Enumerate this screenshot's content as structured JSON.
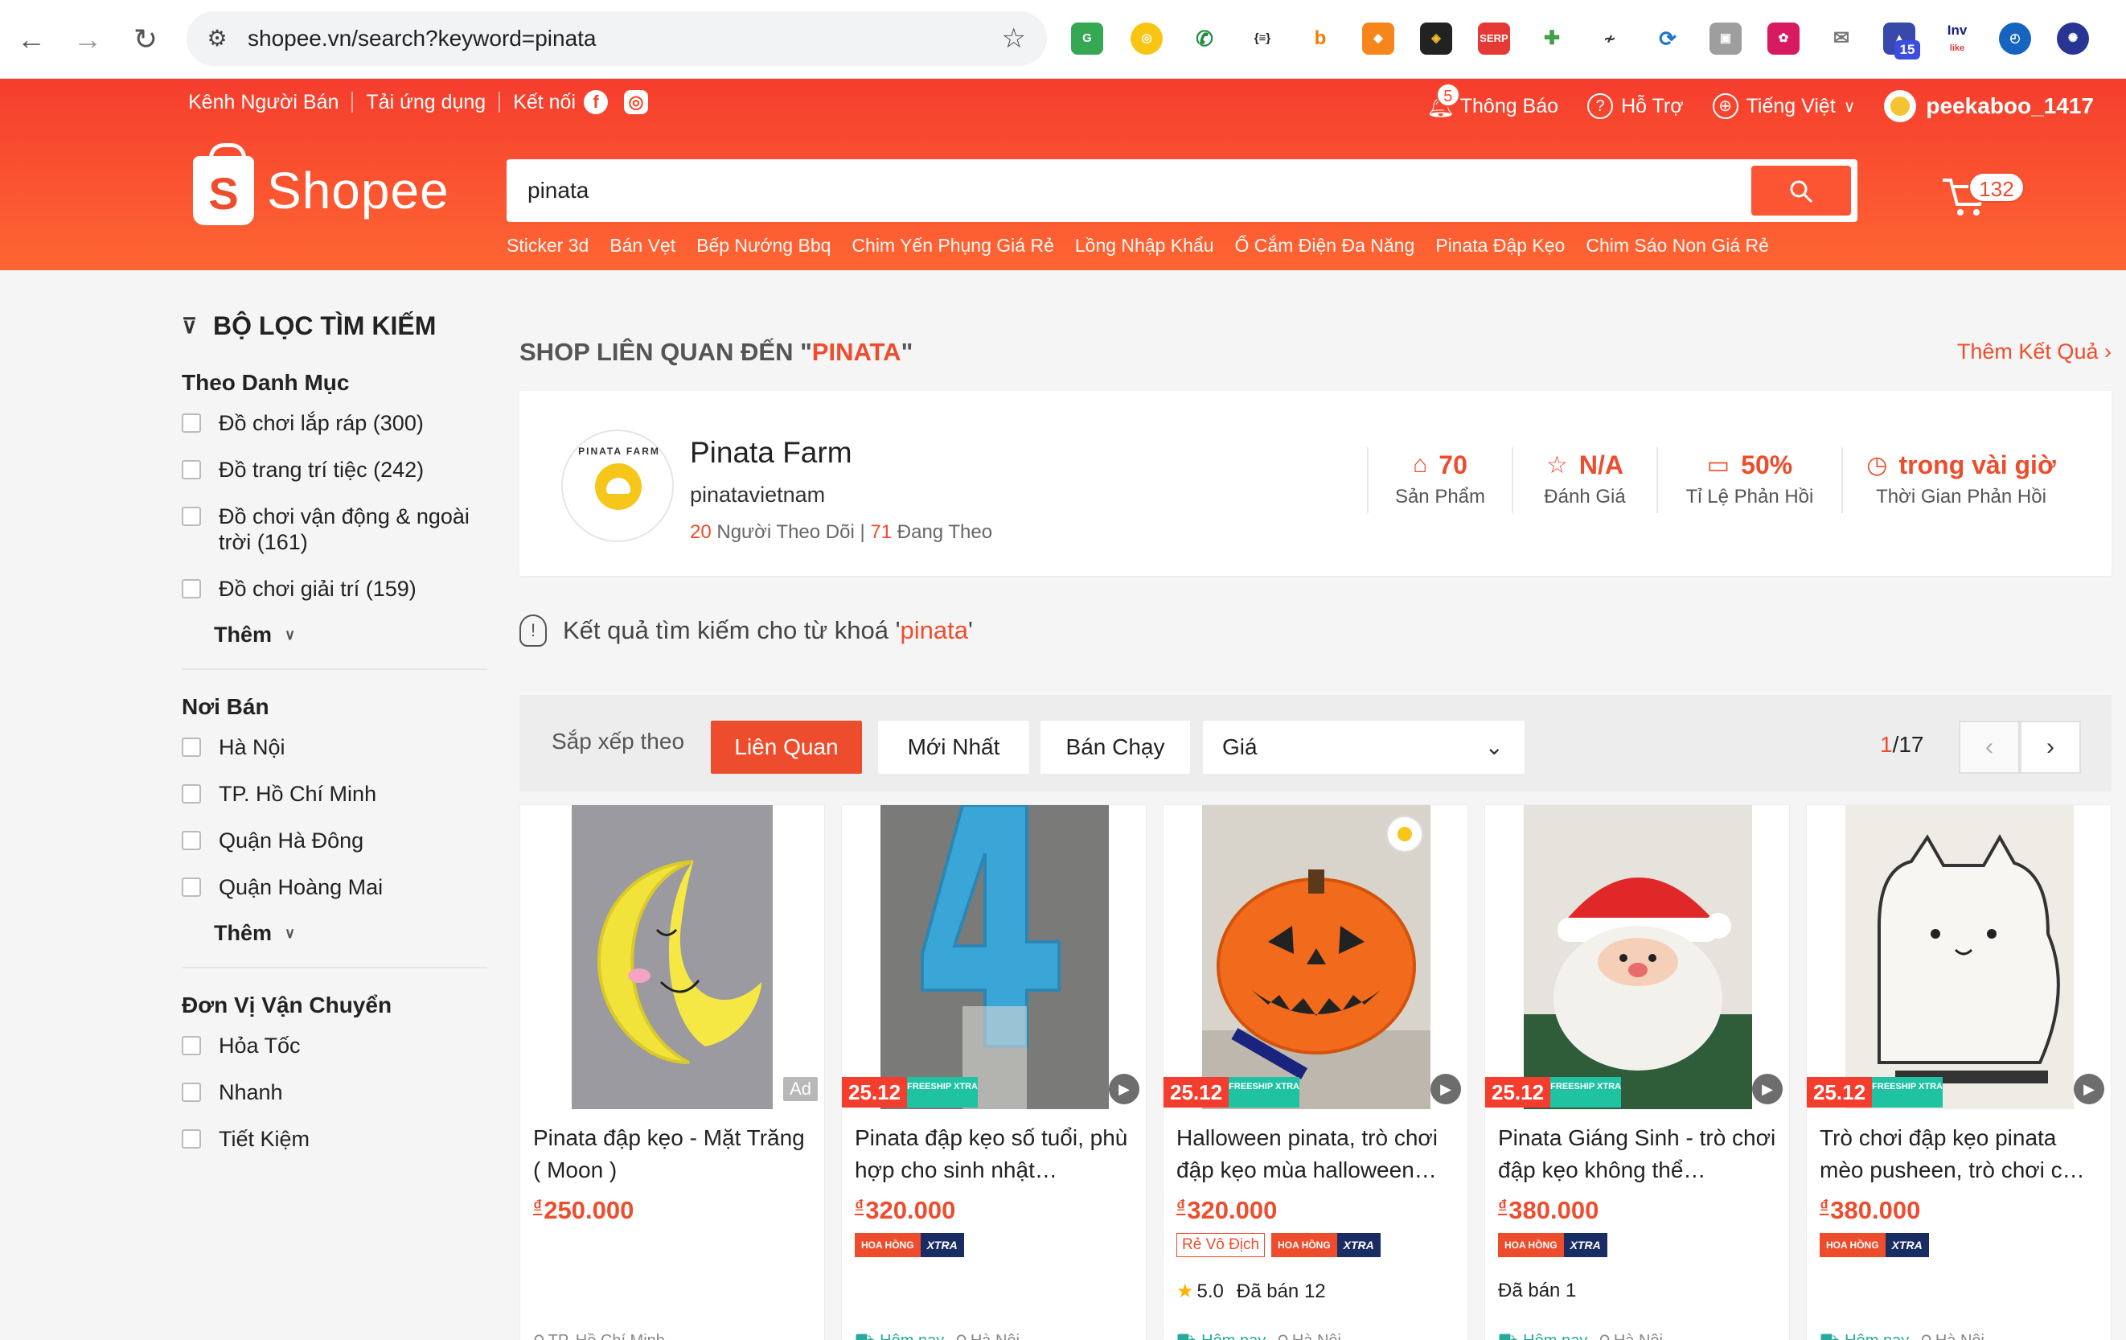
{
  "browser": {
    "url": "shopee.vn/search?keyword=pinata",
    "extension_badge": "15"
  },
  "topnav": {
    "seller_center": "Kênh Người Bán",
    "download_app": "Tải ứng dụng",
    "connect": "Kết nối",
    "notifications": "Thông Báo",
    "notification_count": "5",
    "help": "Hỗ Trợ",
    "language": "Tiếng Việt",
    "username": "peekaboo_1417"
  },
  "logo": {
    "text": "Shopee",
    "mark": "S"
  },
  "search": {
    "value": "pinata",
    "suggestions": [
      "Sticker 3d",
      "Bán Vẹt",
      "Bếp Nướng Bbq",
      "Chim Yến Phụng Giá Rẻ",
      "Lồng Nhập Khẩu",
      "Ổ Cắm Điện Đa Năng",
      "Pinata Đập Kẹo",
      "Chim Sáo Non Giá Rẻ"
    ]
  },
  "cart": {
    "count": "132"
  },
  "filters": {
    "title": "BỘ LỌC TÌM KIẾM",
    "category": {
      "title": "Theo Danh Mục",
      "options": [
        "Đồ chơi lắp ráp (300)",
        "Đồ trang trí tiệc (242)",
        "Đồ chơi vận động & ngoài trời (161)",
        "Đồ chơi giải trí (159)"
      ],
      "more": "Thêm"
    },
    "location": {
      "title": "Nơi Bán",
      "options": [
        "Hà Nội",
        "TP. Hồ Chí Minh",
        "Quận Hà Đông",
        "Quận Hoàng Mai"
      ],
      "more": "Thêm"
    },
    "shipping": {
      "title": "Đơn Vị Vận Chuyển",
      "options": [
        "Hỏa Tốc",
        "Nhanh",
        "Tiết Kiệm"
      ]
    }
  },
  "shop_section": {
    "heading_prefix": "SHOP LIÊN QUAN ĐẾN \"",
    "heading_keyword": "PINATA",
    "heading_suffix": "\"",
    "more_results": "Thêm Kết Quả",
    "shop": {
      "name": "Pinata Farm",
      "handle": "pinatavietnam",
      "logo_text": "PINATA FARM",
      "followers": "20",
      "followers_label": "Người Theo Dõi",
      "following": "71",
      "following_label": "Đang Theo",
      "stats": [
        {
          "value": "70",
          "label": "Sản Phẩm",
          "icon": "shop-icon"
        },
        {
          "value": "N/A",
          "label": "Đánh Giá",
          "icon": "star-icon"
        },
        {
          "value": "50%",
          "label": "Tỉ Lệ Phản Hồi",
          "icon": "chat-icon"
        },
        {
          "value": "trong vài giờ",
          "label": "Thời Gian Phản Hồi",
          "icon": "clock-icon"
        }
      ]
    }
  },
  "results": {
    "prefix": "Kết quả tìm kiếm cho từ khoá '",
    "keyword": "pinata",
    "suffix": "'"
  },
  "sort": {
    "label": "Sắp xếp theo",
    "options": [
      "Liên Quan",
      "Mới Nhất",
      "Bán Chạy"
    ],
    "active": "Liên Quan",
    "price": "Giá",
    "page_current": "1",
    "page_total": "/17"
  },
  "products": [
    {
      "name": "Pinata đập kẹo - Mặt Trăng ( Moon )",
      "price": "250.000",
      "ad": "Ad",
      "location": "TP. Hồ Chí Minh"
    },
    {
      "name": "Pinata đập kẹo số tuổi, phù hợp cho sinh nhật…",
      "price": "320.000",
      "promo": "25.12",
      "ship": "FREESHIP XTRA",
      "badge_a": "HOA HỒNG",
      "badge_b": "XTRA",
      "delivery": "Hôm nay",
      "location": "Hà Nội"
    },
    {
      "name": "Halloween pinata, trò chơi đập kẹo mùa halloween…",
      "price": "320.000",
      "promo": "25.12",
      "ship": "FREESHIP XTRA",
      "rvd": "Rẻ Vô Địch",
      "badge_a": "HOA HỒNG",
      "badge_b": "XTRA",
      "rating": "5.0",
      "sold": "Đã bán 12",
      "delivery": "Hôm nay",
      "location": "Hà Nội"
    },
    {
      "name": "Pinata Giáng Sinh - trò chơi đập kẹo không thể…",
      "price": "380.000",
      "promo": "25.12",
      "ship": "FREESHIP XTRA",
      "badge_a": "HOA HỒNG",
      "badge_b": "XTRA",
      "sold": "Đã bán 1",
      "delivery": "Hôm nay",
      "location": "Hà Nội"
    },
    {
      "name": "Trò chơi đập kẹo pinata mèo pusheen, trò chơi c…",
      "price": "380.000",
      "promo": "25.12",
      "ship": "FREESHIP XTRA",
      "badge_a": "HOA HỒNG",
      "badge_b": "XTRA",
      "delivery": "Hôm nay",
      "location": "Hà Nội"
    }
  ],
  "currency_symbol": "₫",
  "colors": {
    "brand": "#ee4d2d",
    "freeship": "#1fc3a3",
    "xtra": "#1a2c64"
  }
}
